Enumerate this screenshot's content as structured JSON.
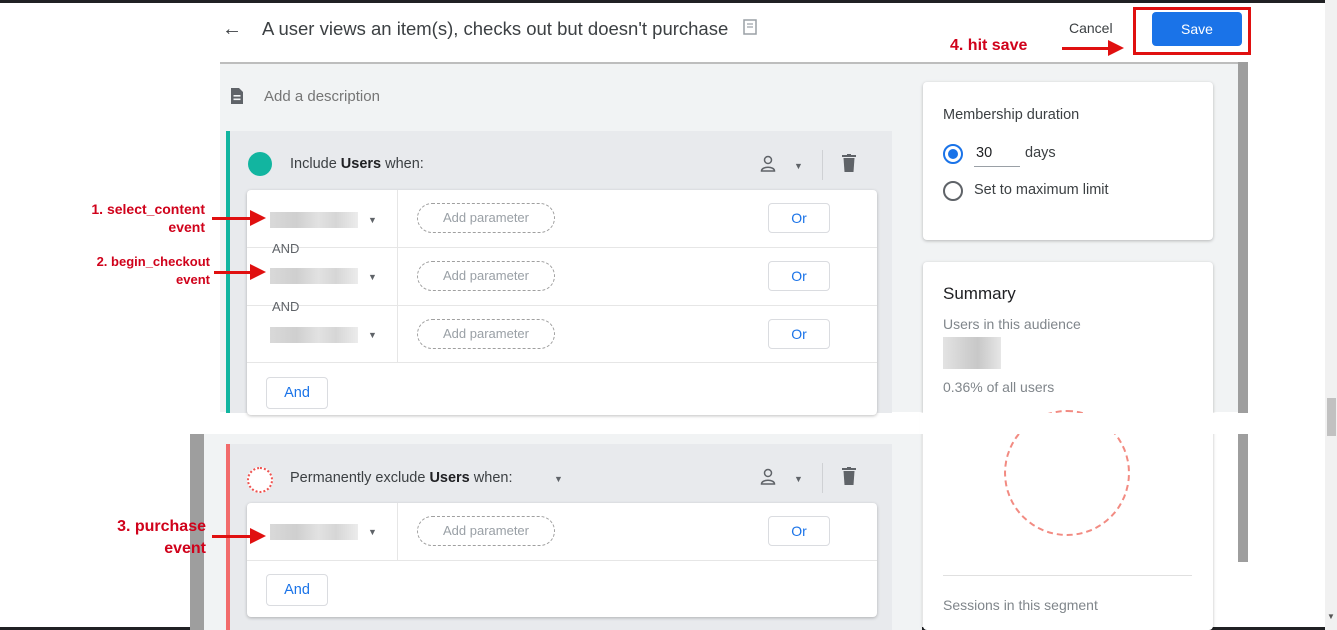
{
  "header": {
    "back_icon": "arrow-left-icon",
    "title": "A user views an item(s), checks out but doesn't purchase",
    "cancel_label": "Cancel",
    "save_label": "Save"
  },
  "description": {
    "icon": "document-icon",
    "placeholder": "Add a description"
  },
  "include_group": {
    "label_prefix": "Include ",
    "label_bold": "Users",
    "label_suffix": " when:",
    "accent_color": "#12b5a0",
    "rows": [
      {
        "parameter_label": "Add parameter",
        "or_label": "Or",
        "connector": "AND"
      },
      {
        "parameter_label": "Add parameter",
        "or_label": "Or",
        "connector": "AND"
      },
      {
        "parameter_label": "Add parameter",
        "or_label": "Or"
      }
    ],
    "and_label": "And"
  },
  "exclude_group": {
    "label_prefix": "Permanently exclude ",
    "label_bold": "Users",
    "label_suffix": " when:",
    "accent_color": "#f26b6b",
    "rows": [
      {
        "parameter_label": "Add parameter",
        "or_label": "Or"
      }
    ],
    "and_label": "And"
  },
  "membership": {
    "title": "Membership duration",
    "duration_value": "30",
    "duration_unit": "days",
    "max_option": "Set to maximum limit"
  },
  "summary": {
    "title": "Summary",
    "users_label": "Users in this audience",
    "percent_text": "0.36% of all users",
    "sessions_label": "Sessions in this segment"
  },
  "annotations": {
    "step1_line1": "1. select_content",
    "step1_line2": "event",
    "step2_line1": "2. begin_checkout",
    "step2_line2": "event",
    "step3_line1": "3. purchase",
    "step3_line2": "event",
    "step4": "4. hit save",
    "color": "#d0021b"
  },
  "colors": {
    "primary": "#1a73e8",
    "annotation": "#e01010"
  }
}
